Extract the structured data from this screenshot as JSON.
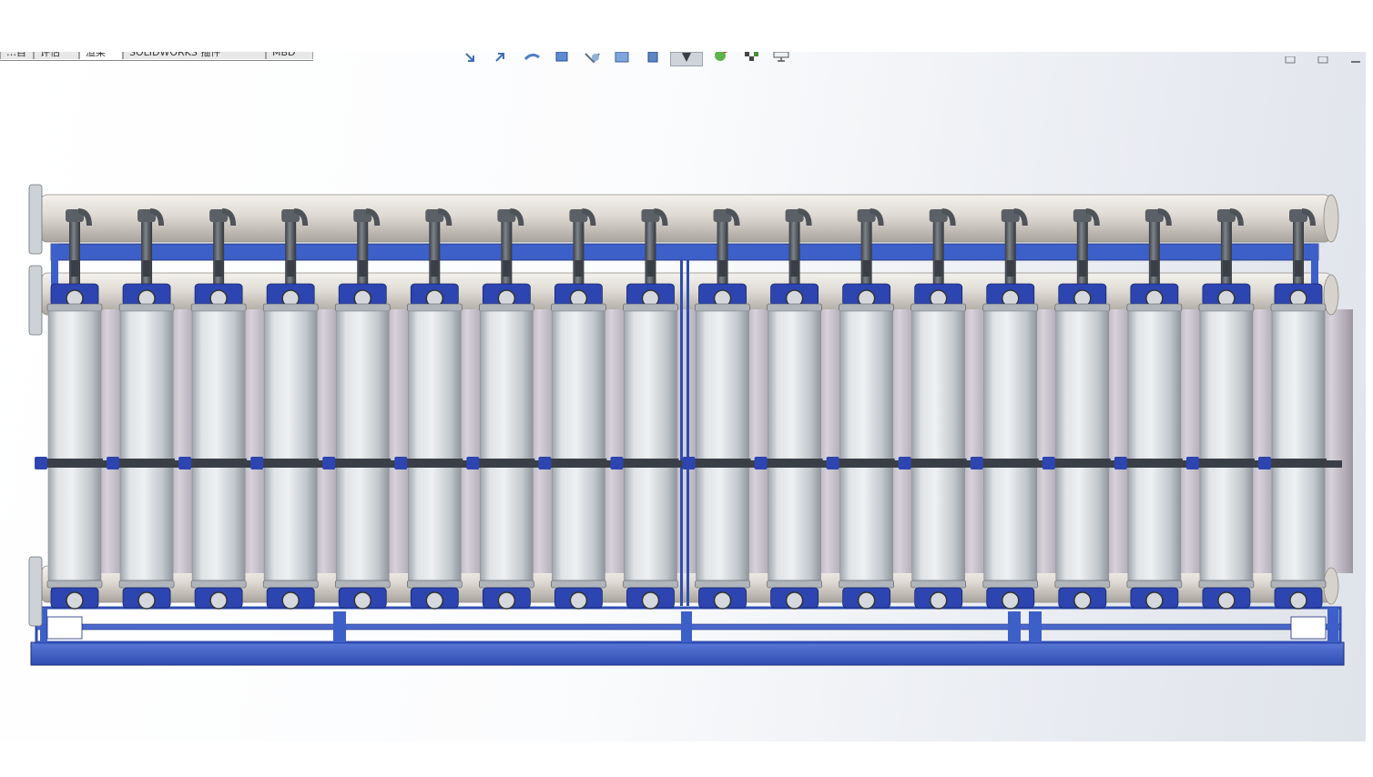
{
  "window": {
    "app": "SOLIDWORKS",
    "background_color": "#f4f6f9"
  },
  "command_manager": {
    "tabs": [
      {
        "label": "…目",
        "active": false
      },
      {
        "label": "评估",
        "active": false
      },
      {
        "label": "渲染",
        "active": true
      },
      {
        "label": "SOLIDWORKS 插件",
        "active": false
      },
      {
        "label": "MBD",
        "active": false
      }
    ]
  },
  "heads_up_toolbar": {
    "icons": [
      "zoom-to-fit-icon",
      "zoom-to-area-icon",
      "previous-view-icon",
      "section-view-icon",
      "dynamic-annotation-icon",
      "view-orientation-icon",
      "display-style-icon",
      "hide-show-items-icon",
      "edit-appearance-icon",
      "apply-scene-icon",
      "view-settings-icon"
    ]
  },
  "window_controls": {
    "icons": [
      "restore-icon",
      "tile-icon",
      "minimize-icon"
    ]
  },
  "model": {
    "name": "ultrafiltration-skid",
    "membrane_module_count": 18,
    "colors": {
      "frame": "#3d5fc8",
      "frame_dark": "#22358a",
      "header_pipe": "#dcd8d2",
      "membrane": "#c9cfd4",
      "valve": "#4e5359",
      "clamp": "#2d45b0"
    }
  }
}
